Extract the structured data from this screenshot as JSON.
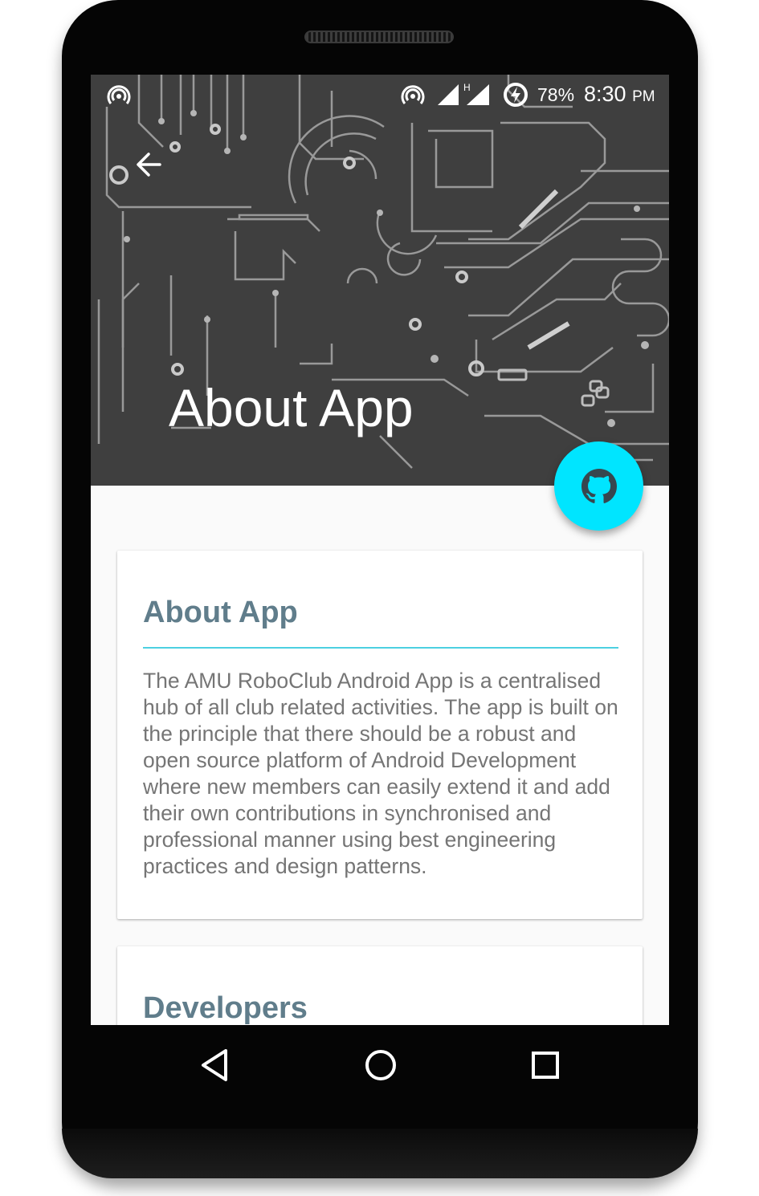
{
  "statusbar": {
    "battery_percent": "78%",
    "time": "8:30",
    "ampm": "PM",
    "network_type": "H",
    "icons": [
      "hotspot-icon",
      "hotspot-icon",
      "signal-icon",
      "signal-icon",
      "battery-charging-icon"
    ]
  },
  "toolbar": {
    "back_icon": "arrow-left-icon",
    "title": "About App"
  },
  "fab": {
    "icon": "github-icon",
    "color": "#00e5ff"
  },
  "cards": [
    {
      "title": "About App",
      "body": "The AMU RoboClub Android App is a centralised hub of all club related activities. The app is built on the principle that there should be a robust and open source platform of Android Development where new members can easily extend it and add their own contributions in synchronised and professional manner using best engineering practices and design patterns."
    },
    {
      "title": "Developers"
    }
  ],
  "navbar": {
    "icons": [
      "back-triangle-icon",
      "home-circle-icon",
      "recents-square-icon"
    ]
  },
  "colors": {
    "header_bg": "#3f3f3f",
    "card_title": "#607d8b",
    "accent_divider": "#4dd0e1",
    "body_text": "#757575"
  }
}
